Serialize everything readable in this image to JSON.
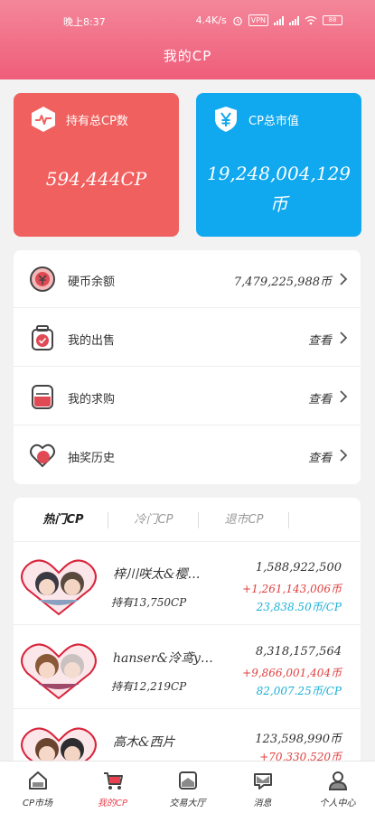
{
  "status_bar": {
    "time": "晚上8:37",
    "speed": "4.4K/s",
    "vpn": "VPN",
    "battery": "88"
  },
  "header": {
    "title": "我的CP"
  },
  "stats": [
    {
      "label": "持有总CP数",
      "value": "594,444CP",
      "icon": "pulse-icon",
      "color": "#f0605e"
    },
    {
      "label": "CP总市值",
      "value": "19,248,004,129币",
      "icon": "yen-shield-icon",
      "color": "#10a8ee"
    }
  ],
  "menu": [
    {
      "label": "硬币余额",
      "value": "7,479,225,988币",
      "icon": "coin-icon"
    },
    {
      "label": "我的出售",
      "value": "查看",
      "icon": "sell-jar-icon"
    },
    {
      "label": "我的求购",
      "value": "查看",
      "icon": "buy-jar-icon"
    },
    {
      "label": "抽奖历史",
      "value": "查看",
      "icon": "heart-history-icon"
    }
  ],
  "tabs": [
    "热门CP",
    "冷门CP",
    "退市CP"
  ],
  "cp_items": [
    {
      "name": "梓川咲太&樱岛麻衣",
      "name_display": "梓川咲太&樱…",
      "holding": "持有13,750CP",
      "value": "1,588,922,500",
      "change": "+1,261,143,006币",
      "unit_price": "23,838.50币/CP"
    },
    {
      "name": "hanser&泠鸢yousa",
      "name_display": "hanser&泠鸢y…",
      "holding": "持有12,219CP",
      "value": "8,318,157,564",
      "change": "+9,866,001,404币",
      "unit_price": "82,007.25币/CP"
    },
    {
      "name": "高木&西片",
      "name_display": "高木&西片",
      "holding": "",
      "value": "123,598,990币",
      "change": "+70,330,520币",
      "unit_price": ""
    }
  ],
  "nav": [
    {
      "label": "CP市场",
      "icon": "house-icon"
    },
    {
      "label": "我的CP",
      "icon": "cart-icon"
    },
    {
      "label": "交易大厅",
      "icon": "exchange-icon"
    },
    {
      "label": "消息",
      "icon": "message-icon"
    },
    {
      "label": "个人中心",
      "icon": "user-icon"
    }
  ],
  "colors": {
    "accent": "#ef5d7a",
    "red": "#f0605e",
    "blue": "#10a8ee",
    "up": "#e04040",
    "price": "#18b0d8"
  }
}
